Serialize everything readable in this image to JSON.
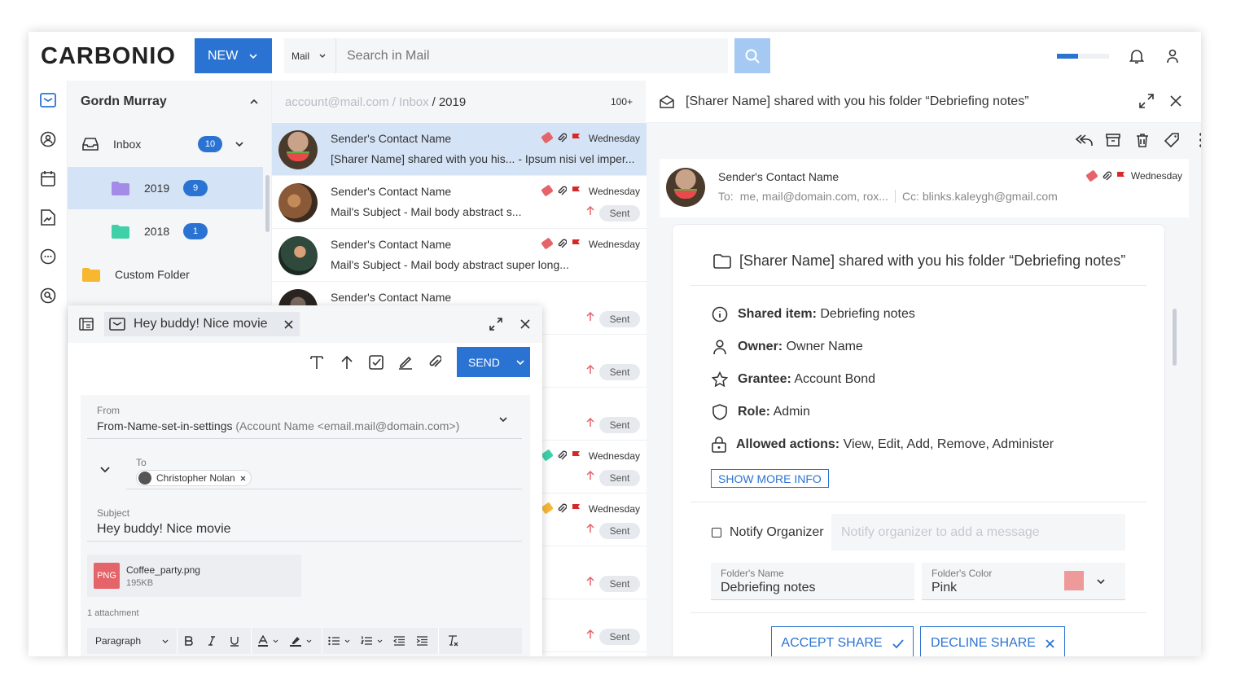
{
  "topbar": {
    "logo": "CARBONIO",
    "new_label": "NEW",
    "search_scope": "Mail",
    "search_placeholder": "Search in Mail",
    "progress": 0.4
  },
  "folders": {
    "account": "Gordn Murray",
    "items": [
      {
        "label": "Inbox",
        "badge": "10"
      },
      {
        "label": "2019",
        "badge": "9"
      },
      {
        "label": "2018",
        "badge": "1"
      },
      {
        "label": "Custom Folder"
      }
    ]
  },
  "list": {
    "crumb_account": "account@mail.com",
    "crumb_sep1": "/",
    "crumb_inbox": "Inbox",
    "crumb_sep2": "/",
    "crumb_folder": "2019",
    "count": "100+",
    "items": [
      {
        "from": "Sender's Contact Name",
        "subject": "[Sharer Name] shared with you his... -  Ipsum nisi vel imper...",
        "date": "Wednesday"
      },
      {
        "from": "Sender's Contact Name",
        "subject": "Mail's Subject -  Mail body abstract s...",
        "date": "Wednesday",
        "status": "Sent"
      },
      {
        "from": "Sender's Contact Name",
        "subject": "Mail's Subject -  Mail body abstract super long...",
        "date": "Wednesday"
      },
      {
        "from": "Sender's Contact Name",
        "status": "Sent"
      },
      {
        "status": "Sent"
      },
      {
        "status": "Sent"
      },
      {
        "date": "Wednesday",
        "status": "Sent"
      },
      {
        "date": "Wednesday",
        "status": "Sent"
      },
      {
        "status": "Sent"
      },
      {
        "status": "Sent"
      }
    ]
  },
  "reader": {
    "title": "[Sharer Name] shared with you his folder “Debriefing notes”",
    "from": "Sender's Contact Name",
    "to_label": "To:",
    "to": "me, mail@domain.com, rox...",
    "cc": "Cc: blinks.kaleygh@gmail.com",
    "date": "Wednesday",
    "card_title": "[Sharer Name] shared with you his folder “Debriefing notes”",
    "shared_item_label": "Shared item:",
    "shared_item": "Debriefing notes",
    "owner_label": "Owner:",
    "owner": "Owner Name",
    "grantee_label": "Grantee:",
    "grantee": "Account Bond",
    "role_label": "Role:",
    "role": "Admin",
    "actions_label": "Allowed actions:",
    "actions": "View, Edit, Add, Remove, Administer",
    "show_more": "SHOW MORE INFO",
    "notify_label": "Notify Organizer",
    "notify_placeholder": "Notify organizer to add a message",
    "folder_name_label": "Folder's Name",
    "folder_name": "Debriefing notes",
    "folder_color_label": "Folder's Color",
    "folder_color": "Pink",
    "folder_color_hex": "#ee9a9a",
    "accept": "ACCEPT SHARE",
    "decline": "DECLINE SHARE"
  },
  "composer": {
    "tab_title": "Hey buddy! Nice movie",
    "send_label": "SEND",
    "from_label": "From",
    "from_name": "From-Name-set-in-settings",
    "from_account": "(Account Name <email.mail@domain.com>)",
    "to_label": "To",
    "to_contact": "Christopher Nolan",
    "subject_label": "Subject",
    "subject": "Hey buddy! Nice movie",
    "attachment_name": "Coffee_party.png",
    "attachment_size": "195KB",
    "attachment_type": "PNG",
    "attachment_count": "1 attachment",
    "format_paragraph": "Paragraph"
  },
  "colors": {
    "accent": "#2b73d2",
    "selected": "#d5e3f6",
    "panel": "#f5f6f8",
    "flag": "#d62828"
  }
}
